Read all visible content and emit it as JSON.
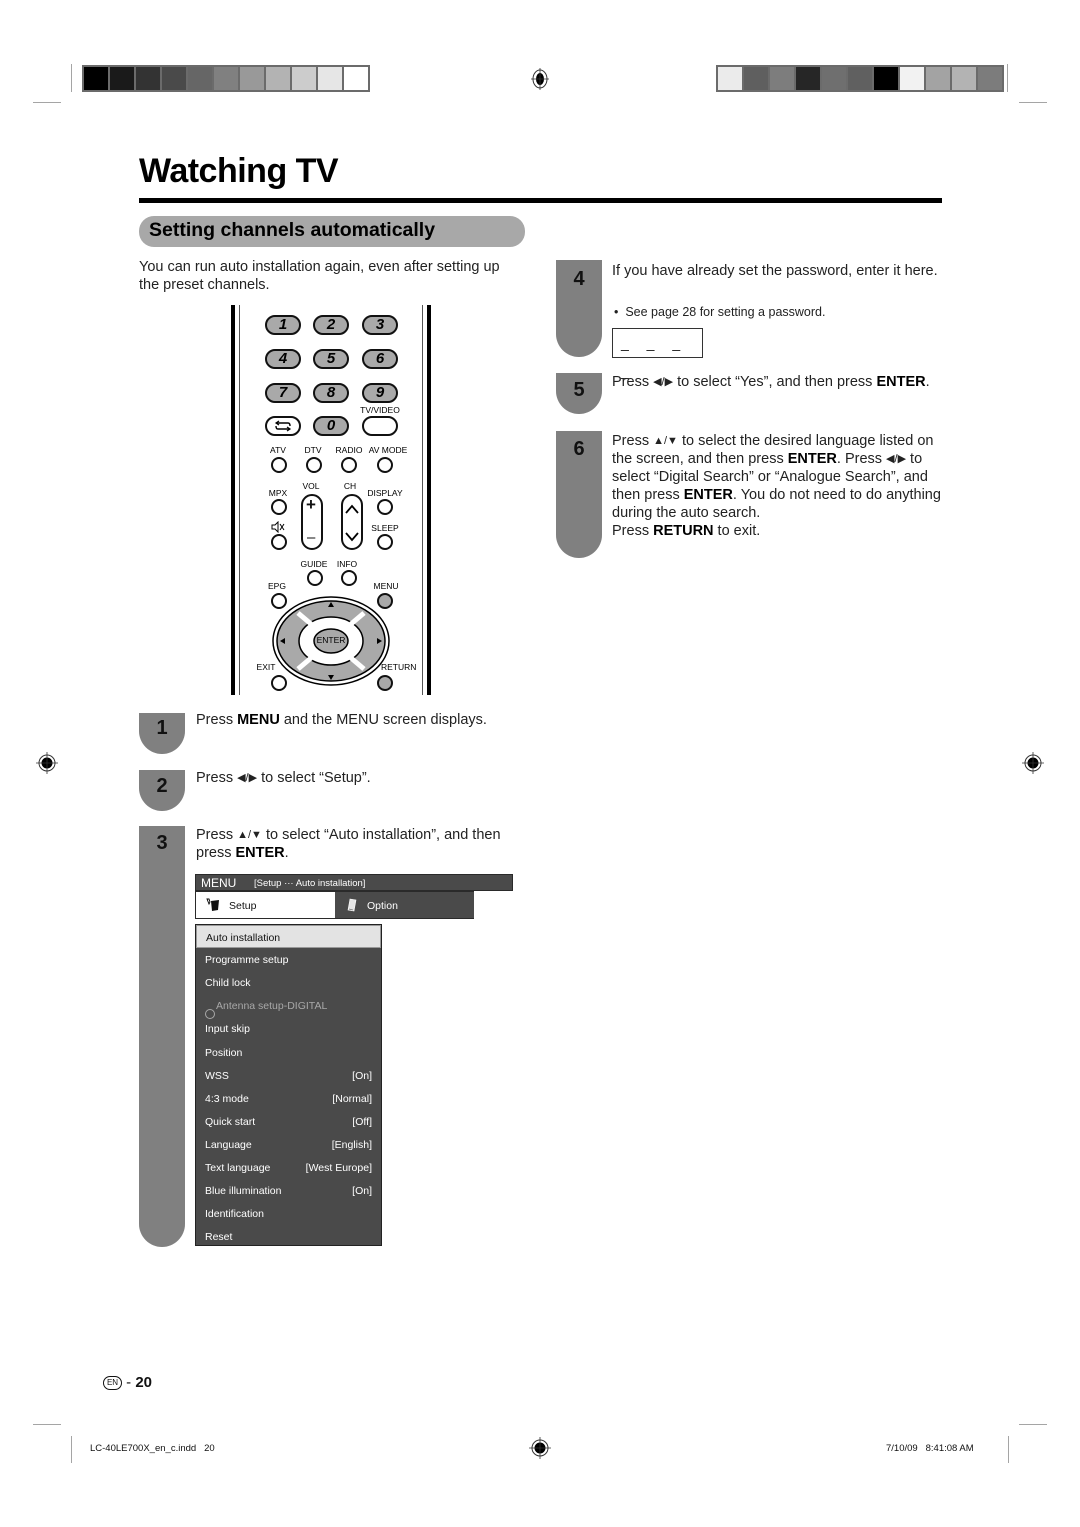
{
  "registration": {
    "left_swatches": [
      "#000000",
      "#1a1a1a",
      "#333333",
      "#4a4a4a",
      "#666666",
      "#808080",
      "#999999",
      "#b3b3b3",
      "#cccccc",
      "#e6e6e6",
      "#ffffff"
    ],
    "right_swatches": [
      "#ebebeb",
      "#5f5f5f",
      "#7d7d7d",
      "#262626",
      "#6f6f6f",
      "#606060",
      "#000000",
      "#f2f2f2",
      "#a3a3a3",
      "#b3b3b3",
      "#7c7c7c"
    ]
  },
  "header": {
    "title": "Watching TV",
    "section": "Setting channels automatically"
  },
  "intro": "You can run auto installation again, even after setting up the preset channels.",
  "remote": {
    "number_keys": [
      "1",
      "2",
      "3",
      "4",
      "5",
      "6",
      "7",
      "8",
      "9",
      "0"
    ],
    "labels": {
      "tv_video": "TV/VIDEO",
      "atv": "ATV",
      "dtv": "DTV",
      "radio": "RADIO",
      "av_mode": "AV MODE",
      "mpx": "MPX",
      "vol": "VOL",
      "ch": "CH",
      "display": "DISPLAY",
      "sleep": "SLEEP",
      "guide": "GUIDE",
      "info": "INFO",
      "epg": "EPG",
      "menu": "MENU",
      "enter": "ENTER",
      "exit": "EXIT",
      "return": "RETURN"
    }
  },
  "steps": [
    {
      "num": "1",
      "pre": "Press ",
      "b1": "MENU",
      "post": " and the MENU screen displays."
    },
    {
      "num": "2",
      "pre": "Press ",
      "arrows": "◀/▶",
      "post": " to select “Setup”."
    },
    {
      "num": "3",
      "pre": "Press ",
      "arrows": "▲/▼",
      "mid": " to select “Auto installation”, and then press ",
      "b1": "ENTER",
      "post": "."
    },
    {
      "num": "4",
      "text": "If you have already set the password, enter it here.",
      "bullet": "See page 28 for setting a password.",
      "password_placeholder": "_ _ _ _"
    },
    {
      "num": "5",
      "pre": "Press ",
      "arrows": "◀/▶",
      "mid": " to select “Yes”, and then press ",
      "b1": "ENTER",
      "post": "."
    },
    {
      "num": "6",
      "l1_pre": "Press ",
      "l1_arrows": "▲/▼",
      "l1_mid": " to select the desired language listed on the screen, and then press ",
      "l1_b": "ENTER",
      "l1_post": ".",
      "l2_pre": " Press ",
      "l2_arrows": "◀/▶",
      "l2_mid": " to select “Digital Search” or “Analogue Search”, and then press ",
      "l2_b": "ENTER",
      "l2_post": ".",
      "l3": " You do not need to do anything during the auto search.",
      "l4_pre": " Press ",
      "l4_b": "RETURN",
      "l4_post": " to exit."
    }
  ],
  "tv_menu": {
    "menu_label": "MENU",
    "breadcrumb": "[Setup ··· Auto installation]",
    "tabs": [
      {
        "label": "Setup",
        "icon": "setup-tools-icon",
        "active": true
      },
      {
        "label": "Option",
        "icon": "option-icon",
        "active": false
      }
    ],
    "items": [
      {
        "label": "Auto installation",
        "value": "",
        "state": "selected"
      },
      {
        "label": "Programme setup",
        "value": "",
        "state": "normal"
      },
      {
        "label": "Child lock",
        "value": "",
        "state": "normal"
      },
      {
        "label": "Antenna setup-DIGITAL",
        "value": "",
        "state": "disabled"
      },
      {
        "label": "Input skip",
        "value": "",
        "state": "normal"
      },
      {
        "label": "Position",
        "value": "",
        "state": "normal"
      },
      {
        "label": "WSS",
        "value": "[On]",
        "state": "normal"
      },
      {
        "label": "4:3 mode",
        "value": "[Normal]",
        "state": "normal"
      },
      {
        "label": "Quick start",
        "value": "[Off]",
        "state": "normal"
      },
      {
        "label": "Language",
        "value": "[English]",
        "state": "normal"
      },
      {
        "label": "Text language",
        "value": "[West Europe]",
        "state": "normal"
      },
      {
        "label": "Blue illumination",
        "value": "[On]",
        "state": "normal"
      },
      {
        "label": "Identification",
        "value": "",
        "state": "normal"
      },
      {
        "label": "Reset",
        "value": "",
        "state": "normal"
      }
    ]
  },
  "footer": {
    "lang_badge": "EN",
    "page_sep": " - ",
    "page_number": "20",
    "file_info": "LC-40LE700X_en_c.indd   20",
    "timestamp": "7/10/09   8:41:08 AM"
  }
}
